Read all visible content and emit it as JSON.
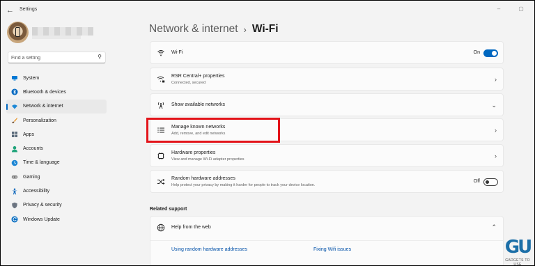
{
  "titlebar": {
    "back_icon": "back-arrow-icon",
    "app_title": "Settings",
    "controls": [
      "minimize-icon",
      "maximize-icon"
    ]
  },
  "user": {
    "avatar_icon": "user-avatar"
  },
  "search": {
    "placeholder": "Find a setting",
    "icon": "search-icon"
  },
  "sidebar": {
    "items": [
      {
        "label": "System",
        "icon": "monitor-icon",
        "icon_color": "#0078d4",
        "active": false
      },
      {
        "label": "Bluetooth & devices",
        "icon": "bluetooth-icon",
        "icon_color": "#0067c0",
        "active": false
      },
      {
        "label": "Network & internet",
        "icon": "wifi-icon",
        "icon_color": "#1b88d6",
        "active": true
      },
      {
        "label": "Personalization",
        "icon": "brush-icon",
        "icon_color": "#e8901c",
        "active": false
      },
      {
        "label": "Apps",
        "icon": "apps-icon",
        "icon_color": "#5a6a7a",
        "active": false
      },
      {
        "label": "Accounts",
        "icon": "person-icon",
        "icon_color": "#1fa37a",
        "active": false
      },
      {
        "label": "Time & language",
        "icon": "globe-clock-icon",
        "icon_color": "#1e86d4",
        "active": false
      },
      {
        "label": "Gaming",
        "icon": "gamepad-icon",
        "icon_color": "#7a7a7a",
        "active": false
      },
      {
        "label": "Accessibility",
        "icon": "accessibility-icon",
        "icon_color": "#1b6fbf",
        "active": false
      },
      {
        "label": "Privacy & security",
        "icon": "shield-icon",
        "icon_color": "#6b7480",
        "active": false
      },
      {
        "label": "Windows Update",
        "icon": "update-icon",
        "icon_color": "#0a6fc2",
        "active": false
      }
    ]
  },
  "breadcrumb": {
    "parent": "Network & internet",
    "separator": "›",
    "current": "Wi-Fi"
  },
  "settings": {
    "wifi": {
      "title": "Wi-Fi",
      "icon": "wifi-icon",
      "state": "On"
    },
    "rsr": {
      "title": "RSR Central+ properties",
      "subtitle": "Connected, secured",
      "icon": "wifi-lock-icon"
    },
    "available": {
      "title": "Show available networks",
      "icon": "antenna-icon"
    },
    "manage": {
      "title": "Manage known networks",
      "subtitle": "Add, remove, and edit networks",
      "icon": "list-icon"
    },
    "hardware": {
      "title": "Hardware properties",
      "subtitle": "View and manage Wi-Fi adapter properties",
      "icon": "chip-icon"
    },
    "random": {
      "title": "Random hardware addresses",
      "subtitle": "Help protect your privacy by making it harder for people to track your device location.",
      "icon": "shuffle-icon",
      "state": "Off"
    }
  },
  "related": {
    "header": "Related support",
    "help_title": "Help from the web",
    "help_icon": "globe-icon",
    "links": [
      "Using random hardware addresses",
      "Fixing Wifi issues"
    ]
  },
  "watermark": {
    "logo_text": "GU",
    "caption": "GADGETS TO USE"
  },
  "colors": {
    "accent": "#0067c0",
    "highlight": "#e3141a",
    "link": "#0050a8",
    "background": "#f3f3f3",
    "card": "#fbfbfb"
  }
}
